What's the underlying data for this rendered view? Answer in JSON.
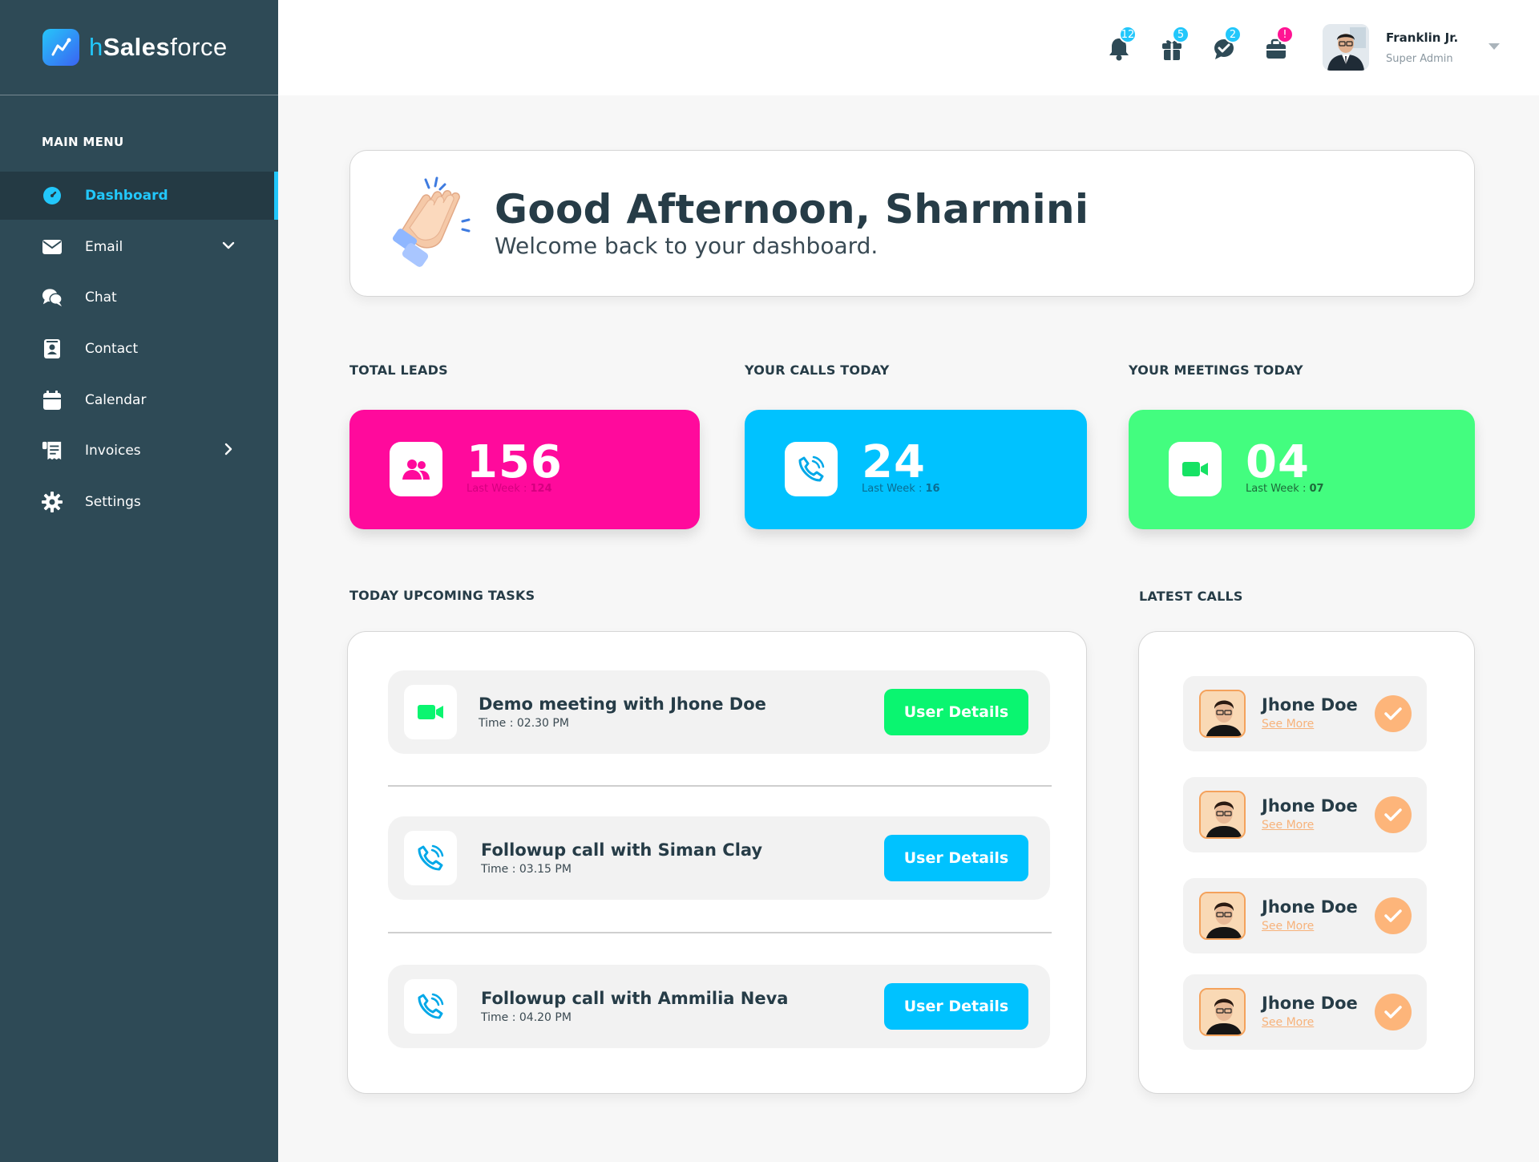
{
  "brand": {
    "prefix": "h",
    "bold": "Sales",
    "light": "force",
    "color": "#22c7fb"
  },
  "sidebar": {
    "heading": "MAIN MENU",
    "items": [
      {
        "label": "Dashboard",
        "icon": "dashboard-icon",
        "active": true
      },
      {
        "label": "Email",
        "icon": "email-icon",
        "chevron": "chevron-down-icon"
      },
      {
        "label": "Chat",
        "icon": "chat-icon"
      },
      {
        "label": "Contact",
        "icon": "contact-icon"
      },
      {
        "label": "Calendar",
        "icon": "calendar-icon"
      },
      {
        "label": "Invoices",
        "icon": "invoice-icon",
        "chevron": "chevron-right-icon"
      },
      {
        "label": "Settings",
        "icon": "gear-icon"
      }
    ]
  },
  "topbar": {
    "notifications": [
      {
        "icon": "bell-icon",
        "badge": "12",
        "color": "#22c7fb"
      },
      {
        "icon": "gift-icon",
        "badge": "5",
        "color": "#22c7fb"
      },
      {
        "icon": "chat-check-icon",
        "badge": "2",
        "color": "#22c7fb"
      },
      {
        "icon": "briefcase-icon",
        "badge": "!",
        "color": "#ff1493"
      }
    ],
    "user": {
      "name": "Franklin Jr.",
      "role": "Super Admin"
    }
  },
  "welcome": {
    "title": "Good Afternoon, Sharmini",
    "subtitle": "Welcome back to your dashboard."
  },
  "stats": [
    {
      "title": "TOTAL LEADS",
      "value": "156",
      "last_label": "Last Week : ",
      "last_value": "124",
      "color": "#ff0a9c",
      "icon": "users-icon"
    },
    {
      "title": "YOUR CALLS TODAY",
      "value": "24",
      "last_label": "Last Week : ",
      "last_value": "16",
      "color": "#00c2ff",
      "icon": "phone-icon"
    },
    {
      "title": "YOUR MEETINGS TODAY",
      "value": "04",
      "last_label": "Last Week : ",
      "last_value": "07",
      "color": "#43fd7f",
      "icon": "video-icon"
    }
  ],
  "tasks": {
    "title": "TODAY UPCOMING TASKS",
    "items": [
      {
        "title": "Demo meeting with Jhone Doe",
        "time": "Time : 02.30 PM",
        "button": "User Details",
        "color": "#0af570",
        "icon": "video-icon"
      },
      {
        "title": "Followup call with Siman Clay",
        "time": "Time : 03.15 PM",
        "button": "User Details",
        "color": "#00c2ff",
        "icon": "phone-icon"
      },
      {
        "title": "Followup call with Ammilia Neva",
        "time": "Time : 04.20 PM",
        "button": "User Details",
        "color": "#00c2ff",
        "icon": "phone-icon"
      }
    ]
  },
  "calls": {
    "title": "LATEST CALLS",
    "items": [
      {
        "name": "Jhone Doe",
        "link": "See More"
      },
      {
        "name": "Jhone Doe",
        "link": "See More"
      },
      {
        "name": "Jhone Doe",
        "link": "See More"
      },
      {
        "name": "Jhone Doe",
        "link": "See More"
      }
    ]
  }
}
